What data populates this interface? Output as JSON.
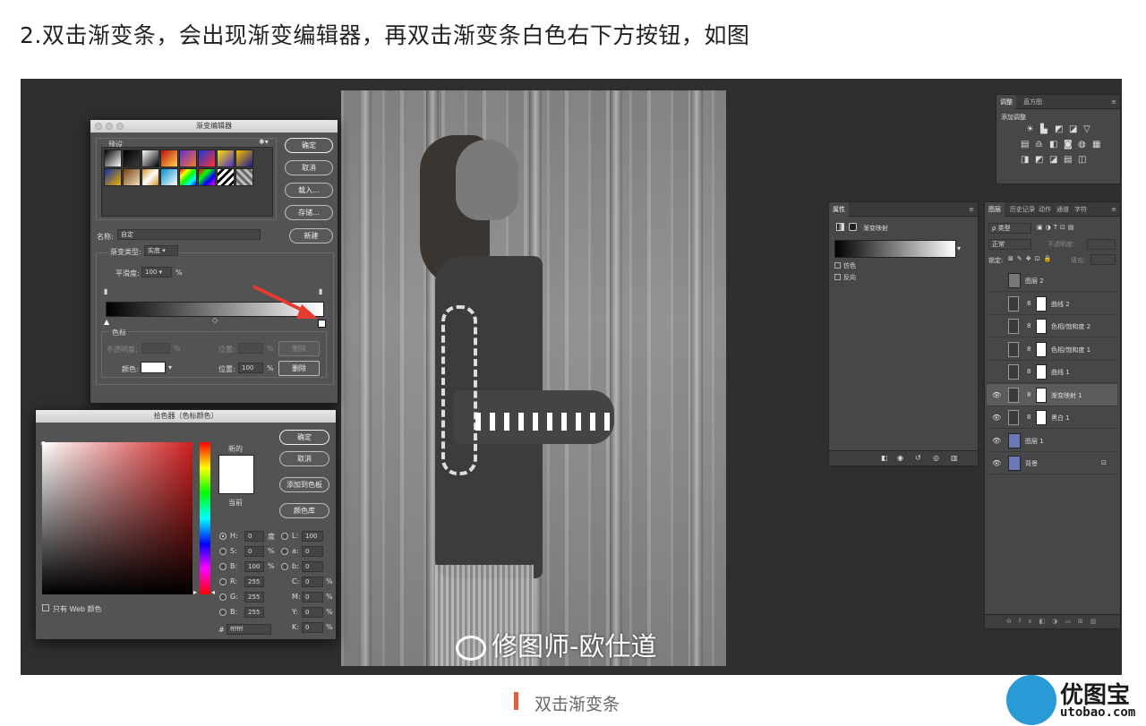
{
  "heading": "2.双击渐变条，会出现渐变编辑器，再双击渐变条白色右下方按钮，如图",
  "caption": "双击渐变条",
  "logo": {
    "text": "优图宝",
    "url": "utobao.com"
  },
  "photo": {
    "watermark": "修图师-欧仕道"
  },
  "gradient_editor": {
    "title": "渐变编辑器",
    "presets_label": "预设",
    "ok": "确定",
    "cancel": "取消",
    "load": "载入...",
    "save": "存储...",
    "name_label": "名称:",
    "name_value": "自定",
    "new": "新建",
    "type_label": "渐变类型:",
    "type_value": "实底",
    "smooth_label": "平滑度:",
    "smooth_value": "100",
    "smooth_unit": "%",
    "stops_label": "色标",
    "opacity_label": "不透明度:",
    "percent": "%",
    "location_label": "位置:",
    "delete": "删除",
    "color_label": "颜色:",
    "location_value": "100"
  },
  "color_picker": {
    "title": "拾色器（色标颜色）",
    "ok": "确定",
    "cancel": "取消",
    "add_swatch": "添加到色板",
    "libraries": "颜色库",
    "new_label": "新的",
    "current_label": "当前",
    "web_only": "只有 Web 颜色",
    "fields": [
      {
        "l": "H:",
        "v": "0",
        "u": "度"
      },
      {
        "l": "S:",
        "v": "0",
        "u": "%"
      },
      {
        "l": "B:",
        "v": "100",
        "u": "%"
      },
      {
        "l": "R:",
        "v": "255",
        "u": ""
      },
      {
        "l": "G:",
        "v": "255",
        "u": ""
      },
      {
        "l": "B:",
        "v": "255",
        "u": ""
      }
    ],
    "fields2": [
      {
        "l": "L:",
        "v": "100",
        "u": ""
      },
      {
        "l": "a:",
        "v": "0",
        "u": ""
      },
      {
        "l": "b:",
        "v": "0",
        "u": ""
      },
      {
        "l": "C:",
        "v": "0",
        "u": "%"
      },
      {
        "l": "M:",
        "v": "0",
        "u": "%"
      },
      {
        "l": "Y:",
        "v": "0",
        "u": "%"
      },
      {
        "l": "K:",
        "v": "0",
        "u": "%"
      }
    ],
    "hex_label": "#",
    "hex_value": "ffffff"
  },
  "adjust_panel": {
    "tab1": "调整",
    "tab2": "直方图",
    "add_label": "添加调整"
  },
  "props_panel": {
    "tab": "属性",
    "type": "渐变映射",
    "dither": "仿色",
    "reverse": "反向"
  },
  "layers_panel": {
    "tabs": [
      "图层",
      "历史记录",
      "动作",
      "通道",
      "字符"
    ],
    "kind_label": "ρ 类型",
    "blend": "正常",
    "opacity": "不透明度:",
    "lock_label": "锁定:",
    "fill": "填充:",
    "layers": [
      {
        "name": "图层 2",
        "visible": false,
        "selected": false
      },
      {
        "name": "曲线 2",
        "visible": false,
        "selected": false
      },
      {
        "name": "色相/饱和度 2",
        "visible": false,
        "selected": false
      },
      {
        "name": "色相/饱和度 1",
        "visible": false,
        "selected": false
      },
      {
        "name": "曲线 1",
        "visible": false,
        "selected": false
      },
      {
        "name": "渐变映射 1",
        "visible": true,
        "selected": true
      },
      {
        "name": "黑白 1",
        "visible": true,
        "selected": false
      },
      {
        "name": "图层 1",
        "visible": true,
        "selected": false
      },
      {
        "name": "背景",
        "visible": true,
        "selected": false
      }
    ]
  }
}
